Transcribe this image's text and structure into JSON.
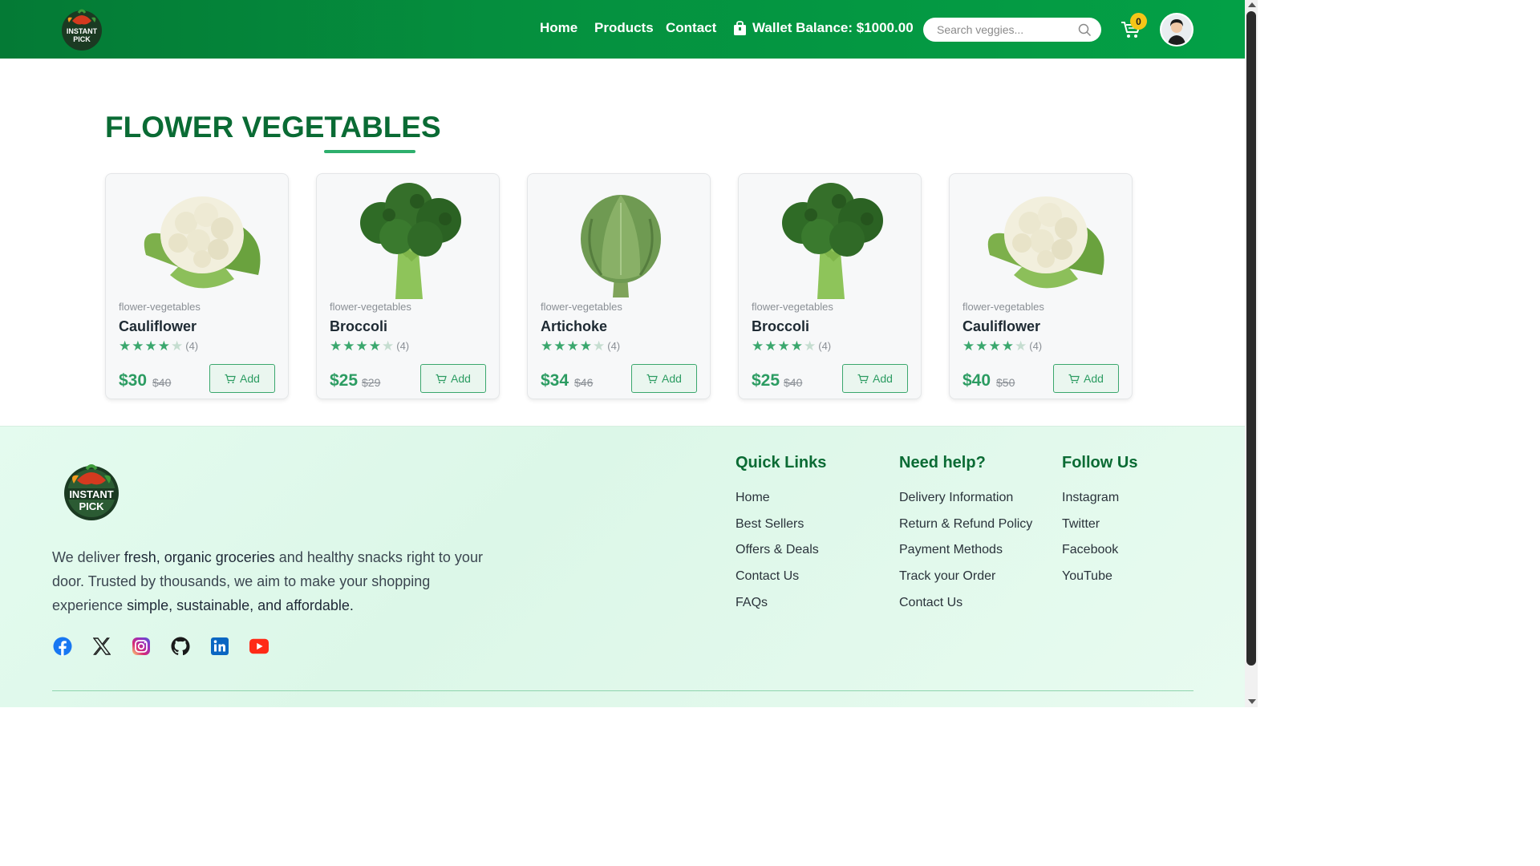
{
  "header": {
    "logo_text_line1": "INSTANT",
    "logo_text_line2": "PICK",
    "nav": [
      "Home",
      "Products",
      "Contact"
    ],
    "wallet_label": "Wallet Balance: $1000.00",
    "search_placeholder": "Search veggies...",
    "cart_count": "0"
  },
  "section": {
    "title": "FLOWER VEGETABLES"
  },
  "products": [
    {
      "category": "flower-vegetables",
      "name": "Cauliflower",
      "rating": 4,
      "rating_count": "(4)",
      "price": "$30",
      "old_price": "$40",
      "add_label": "Add",
      "image": "cauliflower"
    },
    {
      "category": "flower-vegetables",
      "name": "Broccoli",
      "rating": 4,
      "rating_count": "(4)",
      "price": "$25",
      "old_price": "$29",
      "add_label": "Add",
      "image": "broccoli"
    },
    {
      "category": "flower-vegetables",
      "name": "Artichoke",
      "rating": 4,
      "rating_count": "(4)",
      "price": "$34",
      "old_price": "$46",
      "add_label": "Add",
      "image": "artichoke"
    },
    {
      "category": "flower-vegetables",
      "name": "Broccoli",
      "rating": 4,
      "rating_count": "(4)",
      "price": "$25",
      "old_price": "$40",
      "add_label": "Add",
      "image": "broccoli"
    },
    {
      "category": "flower-vegetables",
      "name": "Cauliflower",
      "rating": 4,
      "rating_count": "(4)",
      "price": "$40",
      "old_price": "$50",
      "add_label": "Add",
      "image": "cauliflower"
    }
  ],
  "footer": {
    "about_parts": [
      "We deliver ",
      "fresh, organic groceries",
      " and healthy snacks right to your door. Trusted by thousands, we aim to make your shopping experience ",
      "simple, sustainable, and affordable."
    ],
    "socials": [
      "facebook-icon",
      "x-icon",
      "instagram-icon",
      "github-icon",
      "linkedin-icon",
      "youtube-icon"
    ],
    "columns": [
      {
        "title": "Quick Links",
        "links": [
          "Home",
          "Best Sellers",
          "Offers & Deals",
          "Contact Us",
          "FAQs"
        ]
      },
      {
        "title": "Need help?",
        "links": [
          "Delivery Information",
          "Return & Refund Policy",
          "Payment Methods",
          "Track your Order",
          "Contact Us"
        ]
      },
      {
        "title": "Follow Us",
        "links": [
          "Instagram",
          "Twitter",
          "Facebook",
          "YouTube"
        ]
      }
    ]
  },
  "colors": {
    "header_green": "#05913f",
    "title_green": "#0a6b34",
    "accent_green": "#3aa76d",
    "badge_yellow": "#f5c518"
  }
}
